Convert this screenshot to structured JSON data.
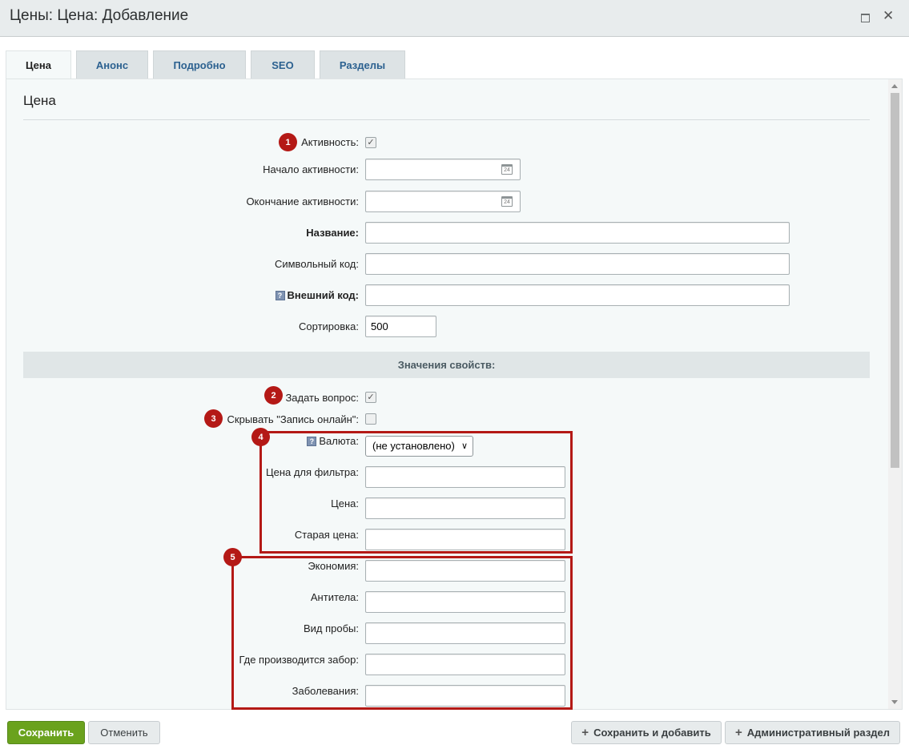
{
  "window": {
    "title": "Цены: Цена: Добавление"
  },
  "tabs": [
    {
      "label": "Цена",
      "active": true
    },
    {
      "label": "Анонс",
      "active": false
    },
    {
      "label": "Подробно",
      "active": false
    },
    {
      "label": "SEO",
      "active": false
    },
    {
      "label": "Разделы",
      "active": false
    }
  ],
  "section": {
    "title": "Цена"
  },
  "form": {
    "active": {
      "label": "Активность:",
      "checked": true
    },
    "active_from": {
      "label": "Начало активности:",
      "value": ""
    },
    "active_to": {
      "label": "Окончание активности:",
      "value": ""
    },
    "name": {
      "label": "Название:",
      "value": ""
    },
    "code": {
      "label": "Символьный код:",
      "value": ""
    },
    "external_code": {
      "label": "Внешний код:",
      "value": ""
    },
    "sort": {
      "label": "Сортировка:",
      "value": "500"
    }
  },
  "properties": {
    "header": "Значения свойств:",
    "ask_question": {
      "label": "Задать вопрос:",
      "checked": true
    },
    "hide_booking": {
      "label": "Скрывать \"Запись онлайн\":",
      "checked": false
    },
    "currency": {
      "label": "Валюта:",
      "selected": "(не установлено)"
    },
    "filter_price": {
      "label": "Цена для фильтра:",
      "value": ""
    },
    "price": {
      "label": "Цена:",
      "value": ""
    },
    "old_price": {
      "label": "Старая цена:",
      "value": ""
    },
    "savings": {
      "label": "Экономия:",
      "value": ""
    },
    "antibodies": {
      "label": "Антитела:",
      "value": ""
    },
    "sample_type": {
      "label": "Вид пробы:",
      "value": ""
    },
    "collection_place": {
      "label": "Где производится забор:",
      "value": ""
    },
    "diseases": {
      "label": "Заболевания:",
      "value": ""
    }
  },
  "calendar_day": "24",
  "help_glyph": "?",
  "annotations": [
    "1",
    "2",
    "3",
    "4",
    "5"
  ],
  "buttons": {
    "save": "Сохранить",
    "cancel": "Отменить",
    "save_add": "Сохранить и добавить",
    "admin": "Административный раздел"
  },
  "colors": {
    "accent_green": "#6aa21d",
    "annotation_red": "#b41916",
    "tab_link": "#2c6190"
  }
}
